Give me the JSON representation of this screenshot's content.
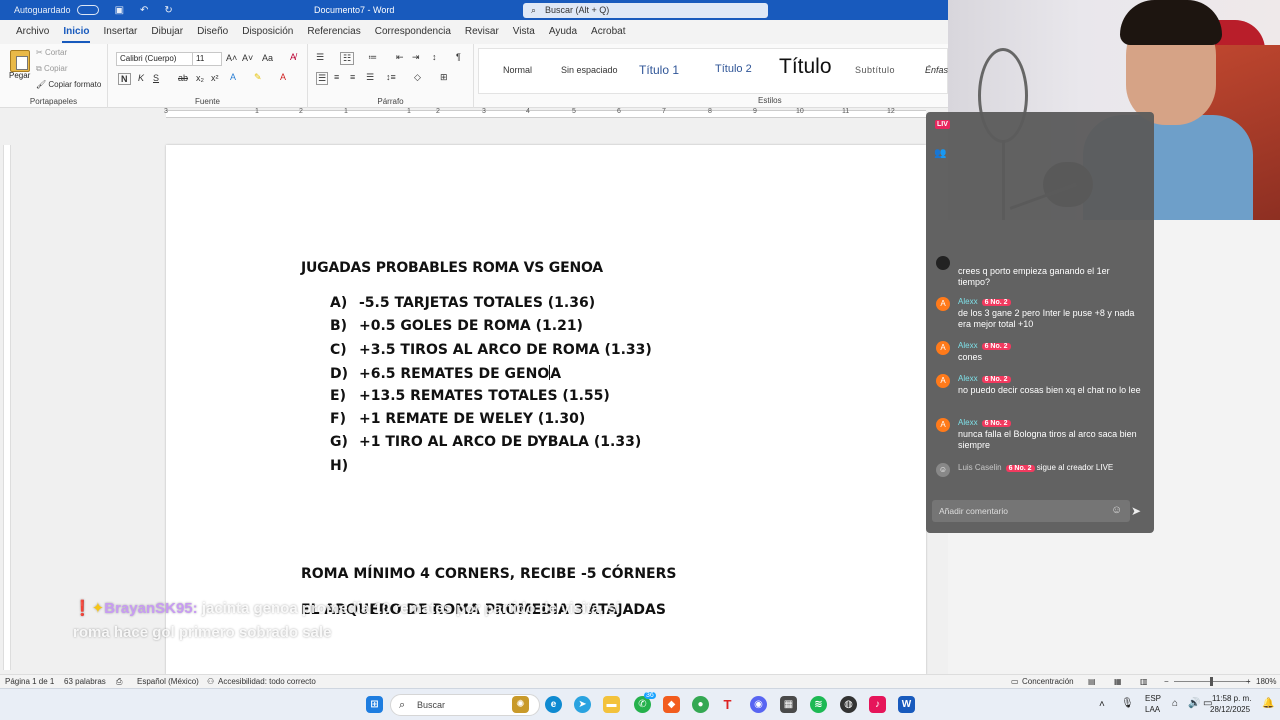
{
  "titlebar": {
    "autosave": "Autoguardado",
    "doc_name": "Documento7 - Word",
    "search_placeholder": "Buscar (Alt + Q)"
  },
  "menu": {
    "tabs": [
      "Archivo",
      "Inicio",
      "Insertar",
      "Dibujar",
      "Diseño",
      "Disposición",
      "Referencias",
      "Correspondencia",
      "Revisar",
      "Vista",
      "Ayuda",
      "Acrobat"
    ],
    "active": "Inicio"
  },
  "ribbon": {
    "clipboard": {
      "paste": "Pegar",
      "cut": "Cortar",
      "copy": "Copiar",
      "format_painter": "Copiar formato",
      "label": "Portapapeles"
    },
    "font": {
      "family": "Calibri (Cuerpo)",
      "size": "11",
      "label": "Fuente"
    },
    "paragraph": {
      "label": "Párrafo"
    },
    "styles": {
      "items": [
        "Normal",
        "Sin espaciado",
        "Título 1",
        "Título 2",
        "Título",
        "Subtítulo",
        "Énfas"
      ],
      "label": "Estilos"
    }
  },
  "ruler": [
    "3",
    "1",
    "2",
    "1",
    "1",
    "2",
    "3",
    "4",
    "5",
    "6",
    "7",
    "8",
    "9",
    "10",
    "11",
    "12",
    "13"
  ],
  "document": {
    "title": "JUGADAS PROBABLES ROMA VS GENOA",
    "items": [
      {
        "letter": "A)",
        "text": "-5.5 TARJETAS TOTALES (1.36)"
      },
      {
        "letter": "B)",
        "text": "+0.5 GOLES DE ROMA (1.21)"
      },
      {
        "letter": "C)",
        "text": "+3.5 TIROS AL ARCO DE ROMA (1.33)"
      },
      {
        "letter": "D)",
        "text": "+6.5 REMATES DE GENO",
        "after_caret": "A"
      },
      {
        "letter": "E)",
        "text": "+13.5 REMATES TOTALES (1.55)"
      },
      {
        "letter": "F)",
        "text": "+1 REMATE DE WELEY (1.30)"
      },
      {
        "letter": "G)",
        "text": "+1 TIRO AL ARCO DE DYBALA (1.33)"
      },
      {
        "letter": "H)",
        "text": ""
      }
    ],
    "line1": "ROMA MÍNIMO 4 CORNERS, RECIBE -5 CÓRNERS",
    "line2": "EL ARQUERO DE ROMA PROMEDIA 3 ATAJADAS"
  },
  "statusbar": {
    "page": "Página 1 de 1",
    "words": "63 palabras",
    "language": "Español (México)",
    "accessibility": "Accesibilidad: todo correcto",
    "focus": "Concentración",
    "zoom": "180%"
  },
  "taskbar": {
    "search": "Buscar",
    "lang": "ESP",
    "lang2": "LAA",
    "time": "11:58 p. m.",
    "date": "28/12/2025",
    "badge": "36"
  },
  "chat": {
    "live": "LIV",
    "messages": [
      {
        "user": "",
        "badge": "",
        "text": "crees q porto empieza ganando el 1er tiempo?",
        "avatar": ""
      },
      {
        "user": "Alexx",
        "badge": "No. 2",
        "text": "de los 3 gane 2 pero Inter le puse +8 y nada era mejor total +10",
        "avatar": "A"
      },
      {
        "user": "Alexx",
        "badge": "No. 2",
        "text": "cones",
        "avatar": "A"
      },
      {
        "user": "Alexx",
        "badge": "No. 2",
        "text": "no puedo decir cosas bien xq el chat no lo lee",
        "avatar": "A"
      },
      {
        "user": "Alexx",
        "badge": "No. 2",
        "text": "nunca falla el Bologna tiros al arco saca bien siempre",
        "avatar": "A"
      }
    ],
    "system": {
      "user": "Luis Caselin",
      "badge": "No. 2",
      "text": "sigue al creador LIVE"
    },
    "input_placeholder": "Añadir comentario"
  },
  "overlay": {
    "user": "BrayanSK95:",
    "text": "jacinta genoa promedia 10 remates por partido de visita, si roma hace gol primero sobrado sale"
  },
  "colors": {
    "word_blue": "#185abd",
    "badge_pink": "#f23a5f",
    "chat_user": "#7ee0e8",
    "overlay_user": "#c79bf2"
  }
}
